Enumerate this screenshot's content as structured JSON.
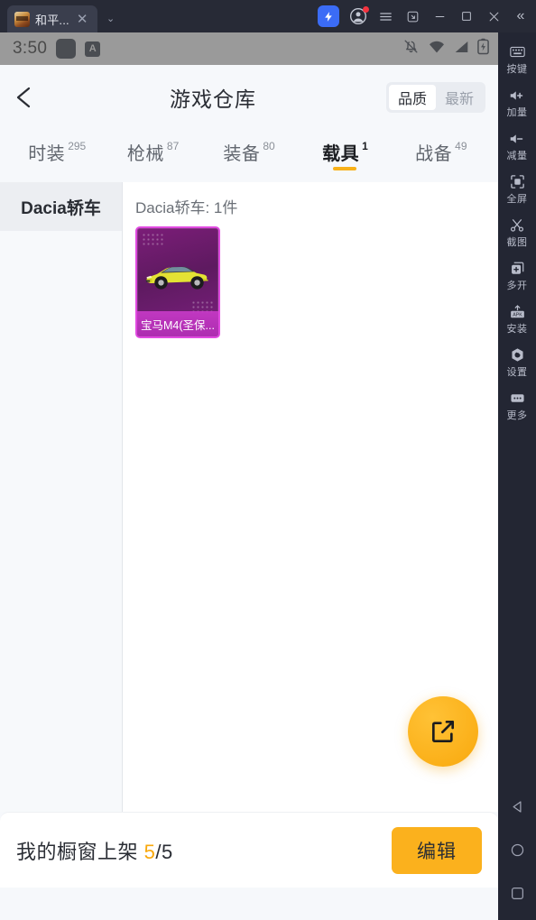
{
  "titlebar": {
    "tab_label": "和平...",
    "tab_close": "✕",
    "tab_dropdown": "⌄",
    "buttons": {
      "boost": "boost-icon",
      "account": "account-icon",
      "menu": "menu-icon",
      "restore": "restore-icon",
      "minimize": "minimize-icon",
      "maximize": "maximize-icon",
      "close": "close-icon",
      "collapse": "«"
    }
  },
  "statusbar": {
    "time": "3:50",
    "letter_icon": "A",
    "icons": [
      "bell-off-icon",
      "wifi-icon",
      "signal-icon",
      "battery-charging-icon"
    ]
  },
  "appbar": {
    "back": "‹",
    "title": "游戏仓库",
    "segments": [
      {
        "label": "品质",
        "active": true
      },
      {
        "label": "最新",
        "active": false
      }
    ]
  },
  "tabs": [
    {
      "name": "时装",
      "count": "295",
      "active": false
    },
    {
      "name": "枪械",
      "count": "87",
      "active": false
    },
    {
      "name": "装备",
      "count": "80",
      "active": false
    },
    {
      "name": "载具",
      "count": "1",
      "active": true
    },
    {
      "name": "战备",
      "count": "49",
      "active": false
    }
  ],
  "sidebar": {
    "items": [
      {
        "label": "Dacia轿车",
        "active": true
      }
    ]
  },
  "content": {
    "group_title": "Dacia轿车: 1件",
    "items": [
      {
        "label": "宝马M4(圣保...",
        "rarity_color": "#e04ae0",
        "image": "yellow-bmw-m4-car"
      }
    ],
    "fab": "share-external-icon"
  },
  "bottombar": {
    "text_prefix": "我的橱窗上架 ",
    "count_current": "5",
    "count_sep": "/",
    "count_total": "5",
    "edit_label": "编辑"
  },
  "toolbar": {
    "items": [
      {
        "label": "按键",
        "icon": "keyboard-icon"
      },
      {
        "label": "加量",
        "icon": "volume-up-icon"
      },
      {
        "label": "减量",
        "icon": "volume-down-icon"
      },
      {
        "label": "全屏",
        "icon": "fullscreen-icon"
      },
      {
        "label": "截图",
        "icon": "scissors-icon"
      },
      {
        "label": "多开",
        "icon": "multi-instance-icon"
      },
      {
        "label": "安装",
        "icon": "apk-install-icon"
      },
      {
        "label": "设置",
        "icon": "settings-icon"
      },
      {
        "label": "更多",
        "icon": "more-icon"
      }
    ],
    "nav": [
      "back-triangle-icon",
      "home-circle-icon",
      "recents-square-icon"
    ]
  },
  "colors": {
    "accent_orange": "#fbb11d",
    "rarity_purple": "#e04ae0",
    "titlebar_bg": "#272a36",
    "toolbar_bg": "#232633"
  }
}
